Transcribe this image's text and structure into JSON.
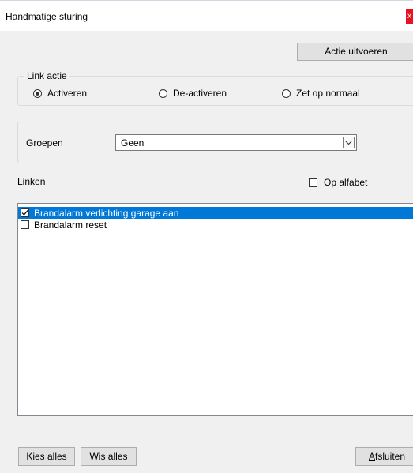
{
  "window": {
    "title": "Handmatige sturing",
    "close_label": "x"
  },
  "toolbar": {
    "actie_label": "Actie uitvoeren"
  },
  "link_actie": {
    "label": "Link actie",
    "options": [
      {
        "label": "Activeren",
        "selected": true
      },
      {
        "label": "De-activeren",
        "selected": false
      },
      {
        "label": "Zet op normaal",
        "selected": false
      }
    ]
  },
  "groepen": {
    "label": "Groepen",
    "value": "Geen"
  },
  "linken": {
    "label": "Linken",
    "alfabet_label": "Op alfabet",
    "alfabet_checked": false,
    "items": [
      {
        "label": "Brandalarm verlichting garage aan",
        "checked": true,
        "selected": true
      },
      {
        "label": "Brandalarm reset",
        "checked": false,
        "selected": false
      }
    ]
  },
  "footer": {
    "kies_label": "Kies alles",
    "wis_label": "Wis alles",
    "afsluiten_prefix": "A",
    "afsluiten_rest": "fsluiten"
  },
  "colors": {
    "selection": "#0078d7",
    "close": "#e81123"
  }
}
